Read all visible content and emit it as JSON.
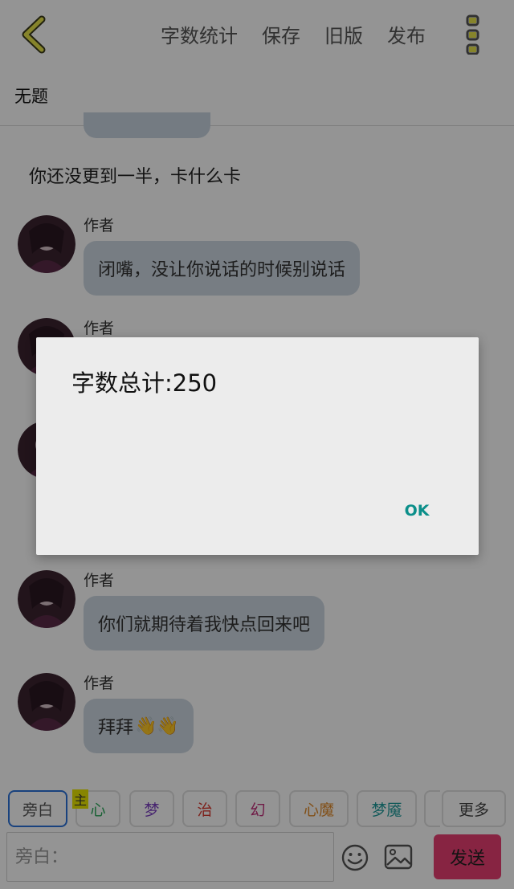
{
  "toolbar": {
    "word_count": "字数统计",
    "save": "保存",
    "old_version": "旧版",
    "publish": "发布"
  },
  "chat": {
    "title": "无题",
    "narration": "你还没更到一半，卡什么卡",
    "messages": [
      {
        "author": "作者",
        "text": "闭嘴，没让你说话的时候别说话"
      },
      {
        "author": "作者",
        "text": ""
      },
      {
        "author": "作者",
        "text": "你们就期待着我快点回来吧"
      },
      {
        "author": "作者",
        "text": "拜拜",
        "emoji": "👋👋"
      }
    ]
  },
  "tags": {
    "narration": "旁白",
    "main_badge": "主",
    "heart": "心",
    "dream": "梦",
    "heal": "治",
    "fantasy": "幻",
    "heart_demon": "心魔",
    "nightmare": "梦魇",
    "more": "更多"
  },
  "tag_colors": {
    "heart": "#2aa85a",
    "dream": "#7a3fc0",
    "heal": "#d9392f",
    "fantasy": "#c2307a",
    "heart_demon": "#e08a2a",
    "nightmare": "#1c9a9a"
  },
  "input": {
    "placeholder": "旁白："
  },
  "send_label": "发送",
  "dialog": {
    "message": "字数总计:250",
    "ok": "OK"
  },
  "colors": {
    "accent_send": "#e83e73",
    "dialog_ok": "#0b8f8a",
    "bubble": "#cdd8e2",
    "back_arrow": "#e7e44a"
  },
  "icons": [
    "back-arrow-icon",
    "more-menu-icon",
    "emoji-icon",
    "image-icon"
  ]
}
